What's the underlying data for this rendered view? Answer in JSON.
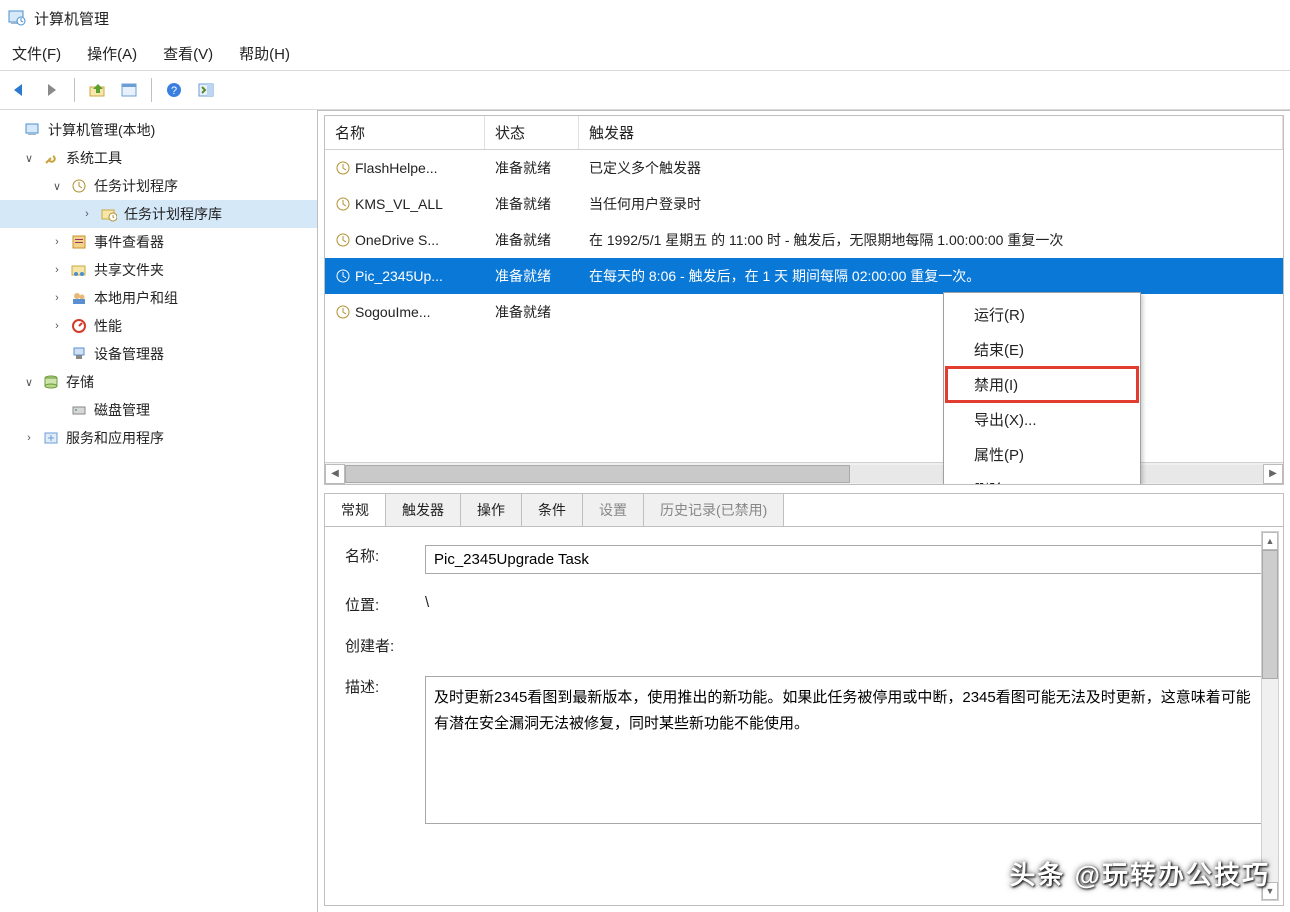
{
  "window": {
    "title": "计算机管理"
  },
  "menu": {
    "file": "文件(F)",
    "action": "操作(A)",
    "view": "查看(V)",
    "help": "帮助(H)"
  },
  "tree": {
    "root": "计算机管理(本地)",
    "systools": "系统工具",
    "sched": "任务计划程序",
    "schedlib": "任务计划程序库",
    "eventvwr": "事件查看器",
    "shared": "共享文件夹",
    "localusers": "本地用户和组",
    "perf": "性能",
    "devmgr": "设备管理器",
    "storage": "存储",
    "diskmgmt": "磁盘管理",
    "services": "服务和应用程序"
  },
  "list": {
    "header": {
      "name": "名称",
      "status": "状态",
      "trigger": "触发器"
    },
    "rows": [
      {
        "name": "FlashHelpe...",
        "status": "准备就绪",
        "trigger": "已定义多个触发器"
      },
      {
        "name": "KMS_VL_ALL",
        "status": "准备就绪",
        "trigger": "当任何用户登录时"
      },
      {
        "name": "OneDrive S...",
        "status": "准备就绪",
        "trigger": "在 1992/5/1 星期五 的 11:00 时 - 触发后，无限期地每隔 1.00:00:00 重复一次"
      },
      {
        "name": "Pic_2345Up...",
        "status": "准备就绪",
        "trigger": "在每天的 8:06 - 触发后，在 1 天 期间每隔 02:00:00 重复一次。"
      },
      {
        "name": "SogouIme...",
        "status": "准备就绪",
        "trigger": ""
      }
    ],
    "selected_index": 3
  },
  "context_menu": {
    "run": "运行(R)",
    "end": "结束(E)",
    "disable": "禁用(I)",
    "export": "导出(X)...",
    "properties": "属性(P)",
    "delete": "删除(D)"
  },
  "tabs": {
    "general": "常规",
    "triggers": "触发器",
    "actions": "操作",
    "conditions": "条件",
    "settings_partial": "设置",
    "history_partial": "历史记录(已禁用)"
  },
  "detail": {
    "name_label": "名称:",
    "name_value": "Pic_2345Upgrade Task",
    "location_label": "位置:",
    "location_value": "\\",
    "creator_label": "创建者:",
    "desc_label": "描述:",
    "desc_value": "及时更新2345看图到最新版本，使用推出的新功能。如果此任务被停用或中断，2345看图可能无法及时更新，这意味着可能有潜在安全漏洞无法被修复，同时某些新功能不能使用。"
  },
  "watermark": "头条 @玩转办公技巧"
}
